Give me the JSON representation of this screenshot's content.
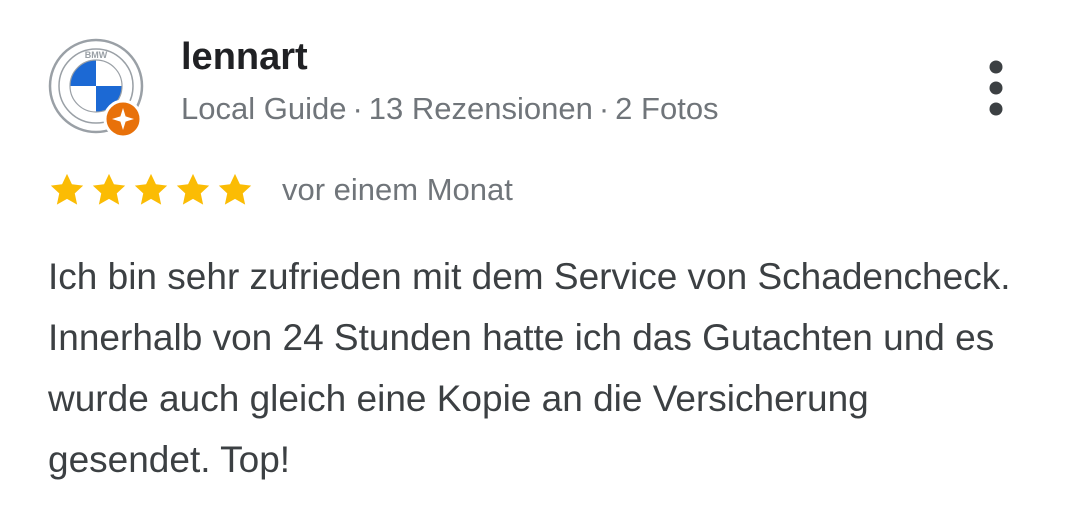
{
  "review": {
    "author": {
      "name": "lennart",
      "avatar_icon": "bmw-logo-avatar-icon",
      "avatar_logo_text": "BMW",
      "badge_icon": "local-guide-badge-icon",
      "level": "Local Guide",
      "reviews_count": "13 Rezensionen",
      "photos_count": "2 Fotos",
      "separator": "·"
    },
    "menu_icon": "more-vert-icon",
    "rating": {
      "stars": 5,
      "max_stars": 5,
      "star_color": "#fbbc04",
      "time": "vor einem Monat"
    },
    "text": "Ich bin sehr zufrieden mit dem Service von Schadencheck. Innerhalb von 24 Stunden hatte ich das Gutachten und es wurde auch gleich eine Kopie an die Versicherung gesendet. Top!"
  }
}
